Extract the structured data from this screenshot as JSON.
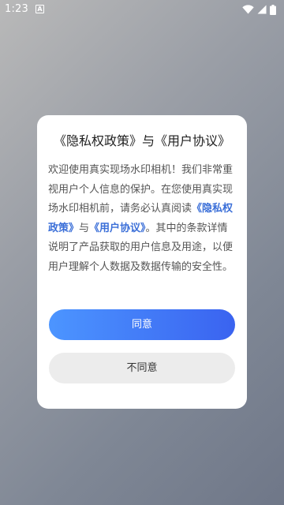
{
  "status_bar": {
    "time": "1:23",
    "notification_icon": "a-letter-icon",
    "icons": [
      "wifi-icon",
      "signal-icon",
      "battery-icon"
    ]
  },
  "dialog": {
    "title": "《隐私权政策》与《用户协议》",
    "body": {
      "intro": "欢迎使用真实现场水印相机！我们非常重视用户个人信息的保护。在您使用真实现场水印相机前，请务必认真阅读",
      "privacy_link": "《隐私权政策》",
      "connector": "与",
      "terms_link": "《用户协议》",
      "outro": "。其中的条款详情说明了产品获取的用户信息及用途，以便用户理解个人数据及数据传输的安全性。"
    },
    "agree_button": "同意",
    "disagree_button": "不同意"
  },
  "colors": {
    "link": "#3b6fd8",
    "agree_gradient_start": "#4c95ff",
    "agree_gradient_end": "#3a63f0",
    "disagree_bg": "#ececec"
  }
}
